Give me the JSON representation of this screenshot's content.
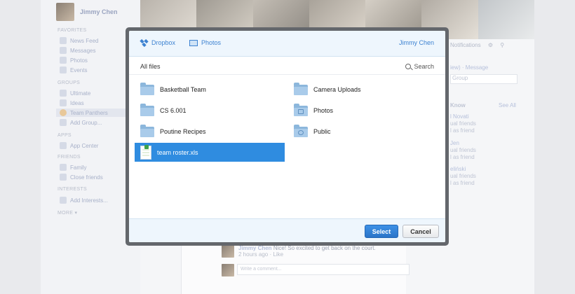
{
  "sidebar": {
    "profile_name": "Jimmy Chen",
    "sections": {
      "favorites": "FAVORITES",
      "groups": "GROUPS",
      "apps": "APPS",
      "friends": "FRIENDS",
      "interests": "INTERESTS",
      "more": "MORE ▾"
    },
    "favorites": [
      "News Feed",
      "Messages",
      "Photos",
      "Events"
    ],
    "groups": [
      "Ultimate",
      "Ideas",
      "Team Panthers",
      "Add Group..."
    ],
    "apps": [
      "App Center"
    ],
    "friends": [
      "Family",
      "Close friends"
    ],
    "interests": [
      "Add Interests..."
    ]
  },
  "right_column": {
    "notifications": "Notifications",
    "message_link": "iew) · Message",
    "group_field": "Group",
    "know_header": "Know",
    "see_all": "See All",
    "people": [
      {
        "name": "l Novati",
        "line1": "ual friends",
        "line2": "l as friend"
      },
      {
        "name": "Jen",
        "line1": "ual friends",
        "line2": "l as friend"
      },
      {
        "name": "eliński",
        "line1": "ual friends",
        "line2": "l as friend"
      }
    ]
  },
  "feed": {
    "comment_author": "Jimmy Chen",
    "comment_text": "Nice! So excited to get back on the court.",
    "comment_meta": "2 hours ago · Like",
    "comment_placeholder": "Write a comment..."
  },
  "dialog": {
    "tabs": {
      "dropbox": "Dropbox",
      "photos": "Photos"
    },
    "user": "Jimmy Chen",
    "breadcrumb": "All files",
    "search_label": "Search",
    "files_left": [
      "Basketball Team",
      "CS 6.001",
      "Poutine Recipes"
    ],
    "selected_file": "team roster.xls",
    "files_right": [
      "Camera Uploads",
      "Photos",
      "Public"
    ],
    "select_label": "Select",
    "cancel_label": "Cancel"
  },
  "colors": {
    "accent": "#3d82d1",
    "selection": "#2f8ce0",
    "dialog_frame": "#64676c",
    "header_bg": "#eef6fd"
  }
}
